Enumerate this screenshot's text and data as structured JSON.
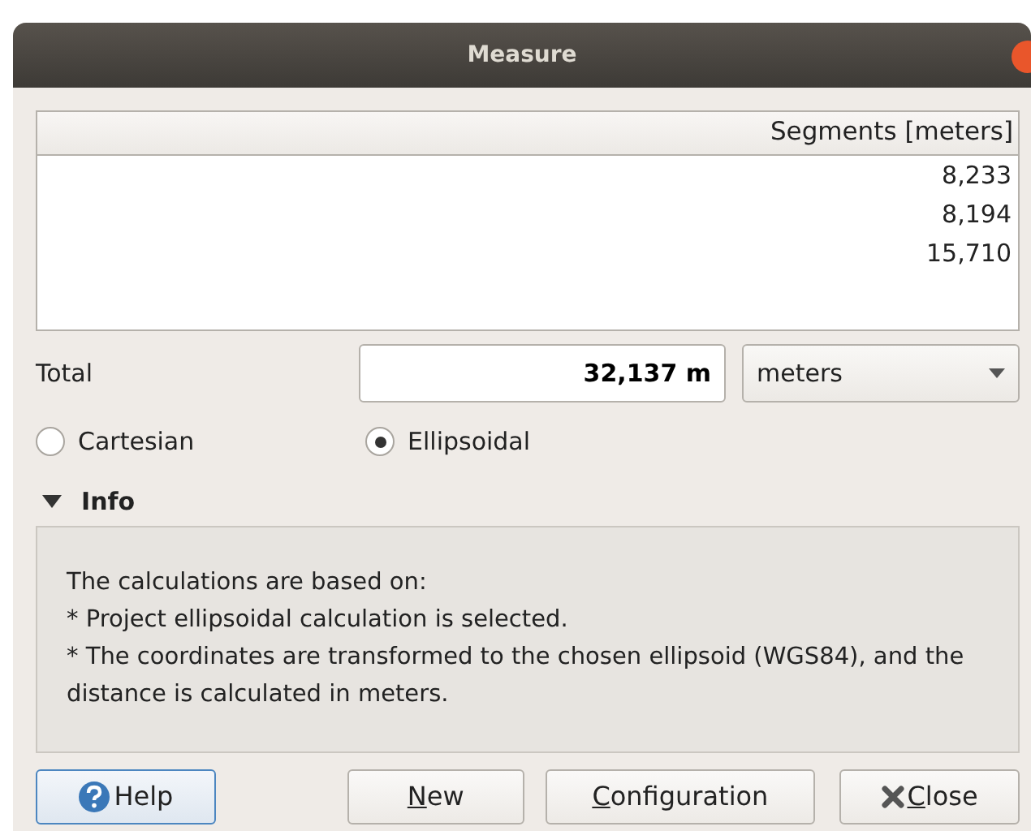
{
  "window": {
    "title": "Measure"
  },
  "table": {
    "columns": [
      "Segments [meters]"
    ],
    "rows": [
      "8,233",
      "8,194",
      "15,710"
    ]
  },
  "total": {
    "label": "Total",
    "value": "32,137 m",
    "unit": "meters"
  },
  "methods": [
    {
      "label": "Cartesian",
      "selected": false
    },
    {
      "label": "Ellipsoidal",
      "selected": true
    }
  ],
  "info": {
    "title": "Info",
    "expanded": true,
    "lines": [
      "The calculations are based on:",
      "* Project ellipsoidal calculation is selected.",
      "* The coordinates are transformed to the chosen ellipsoid (WGS84), and the distance is calculated in meters."
    ]
  },
  "buttons": [
    {
      "kind": "help",
      "label": "Help",
      "mnemonic": false
    },
    {
      "kind": "plain",
      "label": "New",
      "mnemonic": true
    },
    {
      "kind": "plain",
      "label": "Configuration",
      "mnemonic": true
    },
    {
      "kind": "close",
      "label": "Close",
      "mnemonic": true
    }
  ]
}
